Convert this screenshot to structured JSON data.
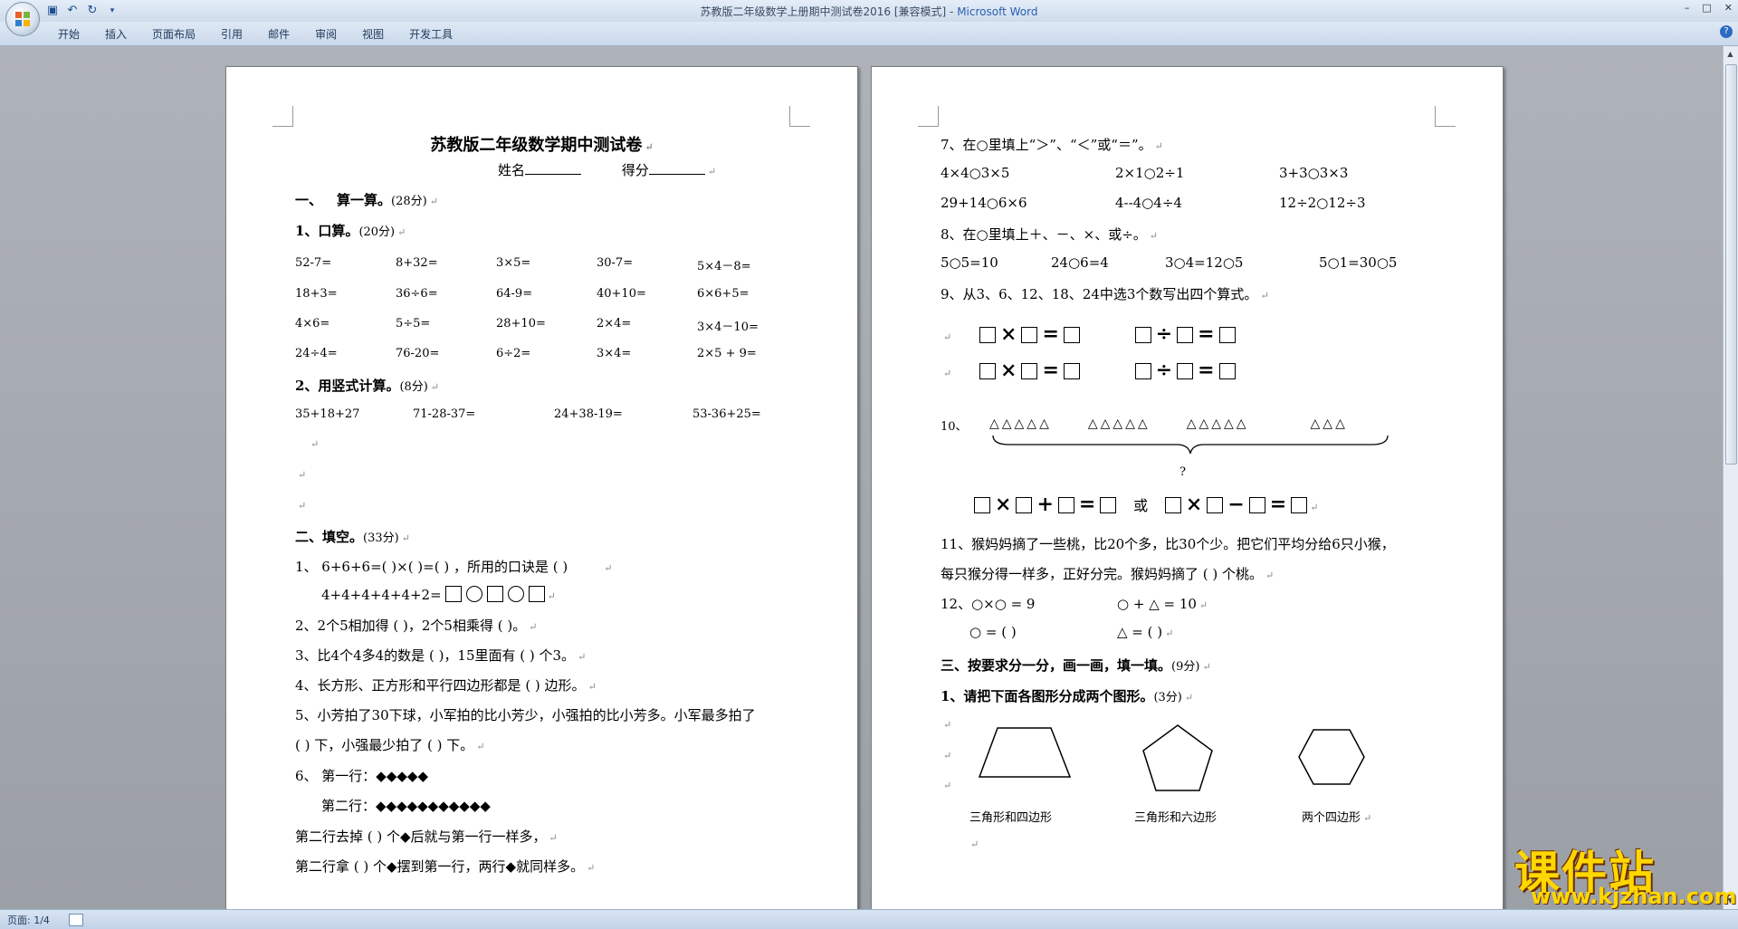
{
  "window": {
    "title": "苏教版二年级数学上册期中测试卷2016 [兼容模式]",
    "app_name": "Microsoft Word",
    "controls": [
      "–",
      "□",
      "✕"
    ]
  },
  "quick_access": [
    "save-icon",
    "undo-icon",
    "redo-icon",
    "customize-icon"
  ],
  "ribbon": {
    "tabs": [
      "开始",
      "插入",
      "页面布局",
      "引用",
      "邮件",
      "审阅",
      "视图",
      "开发工具"
    ]
  },
  "status": {
    "page": "页面: 1/4"
  },
  "page1": {
    "title": "苏教版二年级数学期中测试卷",
    "name_line": "姓名",
    "score_line": "得分",
    "s1_num": "一、",
    "s1_title": "算一算。",
    "s1_pts": "(28分)",
    "s1_1_title": "1、口算。",
    "s1_1_pts": "(20分)",
    "oral_rows": [
      [
        "52-7=",
        "8+32=",
        "3×5=",
        "30-7=",
        "5×4－8="
      ],
      [
        "18+3=",
        "36÷6=",
        "64-9=",
        "40+10=",
        "6×6+5="
      ],
      [
        "4×6=",
        "5÷5=",
        "28+10=",
        "2×4=",
        "3×4－10="
      ],
      [
        "24÷4=",
        "76-20=",
        "6÷2=",
        "3×4=",
        "2×5 + 9="
      ]
    ],
    "s1_2_title": "2、用竖式计算。",
    "s1_2_pts": "(8分)",
    "vertical": [
      "35+18+27",
      "71-28-37=",
      "24+38-19=",
      "53-36+25="
    ],
    "s2_title": "二、填空。",
    "s2_pts": "(33分)",
    "q1": "1、  6+6+6=(    )×(    )=(    ) ，所用的口诀是 (                  )",
    "q1b": "4+4+4+4+4+2=",
    "q2": "2、2个5相加得 (        )，2个5相乘得 (        )。",
    "q3": "3、比4个4多4的数是 (        )，15里面有 (        ) 个3。",
    "q4": "4、长方形、正方形和平行四边形都是 (        ) 边形。",
    "q5a": "5、小芳拍了30下球，小军拍的比小芳少，小强拍的比小芳多。小军最多拍了",
    "q5b": "(        ) 下，小强最少拍了 (        ) 下。",
    "q6a": "6、  第一行：◆◆◆◆◆",
    "q6b": "第二行：◆◆◆◆◆◆◆◆◆◆◆",
    "q6c": "第二行去掉 (        ) 个◆后就与第一行一样多，",
    "q6d": "第二行拿 (        ) 个◆摆到第一行，两行◆就同样多。"
  },
  "page2": {
    "q7": "7、在○里填上“＞”、“＜”或“＝”。",
    "q7_rows": [
      [
        "4×4○3×5",
        "2×1○2÷1",
        "3+3○3×3"
      ],
      [
        "29+14○6×6",
        "4--4○4÷4",
        "12÷2○12÷3"
      ]
    ],
    "q8": "8、在○里填上＋、－、×、或÷。",
    "q8_row": [
      "5○5=10",
      "24○6=4",
      "3○4=12○5",
      "5○1=30○5"
    ],
    "q9": "9、从3、6、12、18、24中选3个数写出四个算式。",
    "q9_ops": [
      "×",
      "÷"
    ],
    "q10_num": "10、",
    "q10_groups": [
      "△△△△△",
      "△△△△△",
      "△△△△△",
      "△△△"
    ],
    "q10_q": "?",
    "q10_or": "或",
    "q10_ops": [
      "×",
      "+",
      "=",
      "×",
      "−",
      "="
    ],
    "q11a": "11、猴妈妈摘了一些桃，比20个多，比30个少。把它们平均分给6只小猴，",
    "q11b": "每只猴分得一样多，正好分完。猴妈妈摘了 (        ) 个桃。",
    "q12a": "12、○×○ = 9",
    "q12b": "○ + △ = 10",
    "q12c": "○ = (        )",
    "q12d": "△ = (        )",
    "s3_title": "三、按要求分一分，画一画，填一填。",
    "s3_pts": "(9分)",
    "s3_1_title": "1、请把下面各图形分成两个图形。",
    "s3_1_pts": "(3分)",
    "shape_labels": [
      "三角形和四边形",
      "三角形和六边形",
      "两个四边形"
    ]
  },
  "watermark": {
    "title": "课件站",
    "url": "www.kjzhan.com"
  }
}
